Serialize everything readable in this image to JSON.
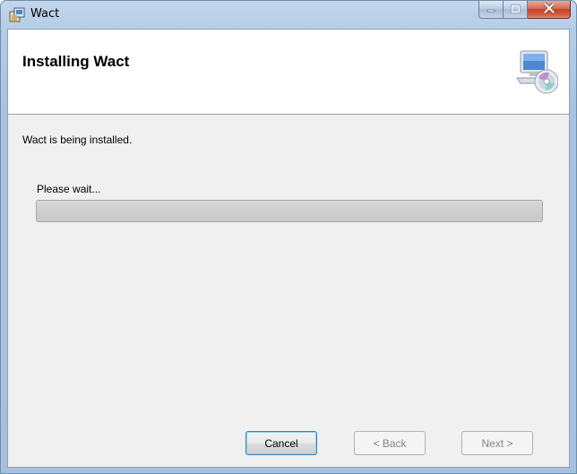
{
  "window": {
    "title": "Wact",
    "app_icon": "installer-icon",
    "caption_buttons": [
      "minimize-icon",
      "maximize-icon",
      "close-icon"
    ]
  },
  "header": {
    "title": "Installing Wact",
    "icon": "computer-disc-icon"
  },
  "body": {
    "status": "Wact is being installed.",
    "wait_label": "Please wait...",
    "progress": 0
  },
  "footer": {
    "cancel_label": "Cancel",
    "back_label": "< Back",
    "next_label": "Next >",
    "back_enabled": false,
    "next_enabled": false
  },
  "colors": {
    "accent_close": "#c2452a",
    "default_button_border": "#3c7fb1",
    "client_background": "#f0f0f0"
  }
}
